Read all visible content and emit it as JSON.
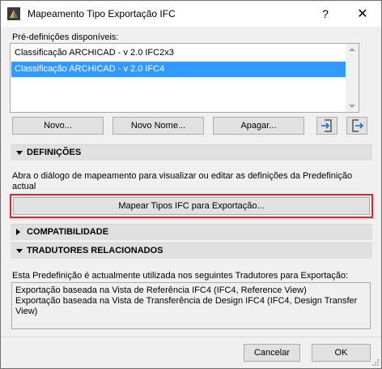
{
  "window": {
    "title": "Mapeamento Tipo Exportação IFC",
    "help_glyph": "?",
    "close_glyph": "✕"
  },
  "presets": {
    "label": "Pré-definições disponíveis:",
    "items": [
      {
        "label": "Classificação ARCHICAD - v 2.0 IFC2x3",
        "selected": false
      },
      {
        "label": "Classificação ARCHICAD - v 2.0 IFC4",
        "selected": true
      }
    ]
  },
  "preset_buttons": {
    "new_label": "Novo...",
    "new_name_label": "Novo Nome...",
    "delete_label": "Apagar...",
    "import_icon": "import-icon",
    "export_icon": "export-icon"
  },
  "sections": {
    "definitions": {
      "title": "DEFINIÇÕES",
      "expanded": true,
      "description": "Abra o diálogo de mapeamento para visualizar ou editar as definições da Predefinição actual",
      "map_button_label": "Mapear Tipos IFC para Exportação..."
    },
    "compatibility": {
      "title": "COMPATIBILIDADE",
      "expanded": false
    },
    "translators": {
      "title": "TRADUTORES RELACIONADOS",
      "expanded": true,
      "description": "Esta Predefinição é actualmente utilizada nos seguintes Tradutores para Exportação:",
      "items": [
        "Exportação baseada na Vista de Referência IFC4 (IFC4, Reference View)",
        "Exportação baseada na Vista de Transferência de Design IFC4 (IFC4, Design Transfer View)"
      ]
    }
  },
  "footer": {
    "cancel_label": "Cancelar",
    "ok_label": "OK"
  },
  "colors": {
    "selection": "#3399ff",
    "highlight_border": "#e8232a",
    "section_header": "#e0e0e0",
    "dialog_background": "#f0f0f0"
  }
}
